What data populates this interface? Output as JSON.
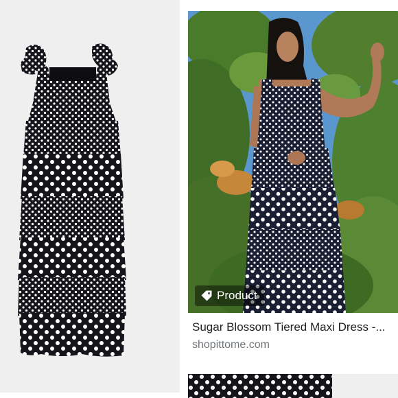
{
  "result": {
    "badge_label": "Product",
    "title": "Sugar Blossom Tiered Maxi Dress -...",
    "source": "shopittome.com"
  },
  "icons": {
    "badge": "tag-icon"
  },
  "colors": {
    "dress": "#15151c",
    "dots": "#ffffff",
    "sky": "#4f8ec9",
    "foliage": "#4d7a2c",
    "caption_title": "#202124",
    "caption_source": "#70757a"
  }
}
